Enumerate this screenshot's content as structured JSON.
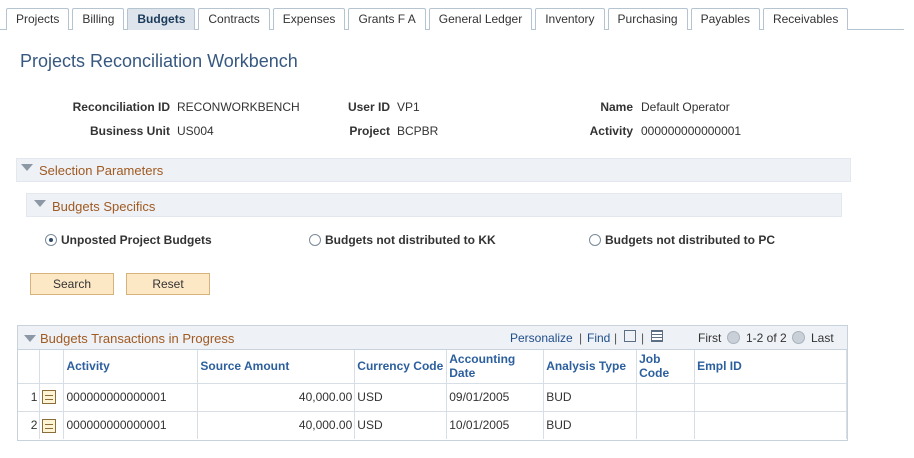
{
  "tabs": [
    {
      "label": "Projects",
      "active": false
    },
    {
      "label": "Billing",
      "active": false
    },
    {
      "label": "Budgets",
      "active": true
    },
    {
      "label": "Contracts",
      "active": false
    },
    {
      "label": "Expenses",
      "active": false
    },
    {
      "label": "Grants F A",
      "active": false
    },
    {
      "label": "General Ledger",
      "active": false
    },
    {
      "label": "Inventory",
      "active": false
    },
    {
      "label": "Purchasing",
      "active": false
    },
    {
      "label": "Payables",
      "active": false
    },
    {
      "label": "Receivables",
      "active": false
    }
  ],
  "page": {
    "title": "Projects Reconciliation Workbench"
  },
  "header": {
    "recon_id_label": "Reconciliation ID",
    "recon_id_value": "RECONWORKBENCH",
    "user_id_label": "User ID",
    "user_id_value": "VP1",
    "name_label": "Name",
    "name_value": "Default Operator",
    "bu_label": "Business Unit",
    "bu_value": "US004",
    "project_label": "Project",
    "project_value": "BCPBR",
    "activity_label": "Activity",
    "activity_value": "000000000000001"
  },
  "selection": {
    "title": "Selection Parameters"
  },
  "specifics": {
    "title": "Budgets Specifics"
  },
  "radios": [
    {
      "label": "Unposted Project Budgets",
      "selected": true
    },
    {
      "label": "Budgets not distributed to KK",
      "selected": false
    },
    {
      "label": "Budgets not distributed to PC",
      "selected": false
    }
  ],
  "buttons": {
    "search": "Search",
    "reset": "Reset"
  },
  "grid": {
    "title": "Budgets Transactions in Progress",
    "personalize": "Personalize",
    "separator": "|",
    "find": "Find",
    "first": "First",
    "range": "1-2 of 2",
    "last": "Last",
    "columns": [
      "Activity",
      "Source Amount",
      "Currency Code",
      "Accounting Date",
      "Analysis Type",
      "Job Code",
      "Empl ID"
    ],
    "rows": [
      {
        "num": "1",
        "activity": "000000000000001",
        "amount": "40,000.00",
        "currency": "USD",
        "date": "09/01/2005",
        "analysis": "BUD",
        "job": "",
        "empl": ""
      },
      {
        "num": "2",
        "activity": "000000000000001",
        "amount": "40,000.00",
        "currency": "USD",
        "date": "10/01/2005",
        "analysis": "BUD",
        "job": "",
        "empl": ""
      }
    ]
  },
  "colors": {
    "accent": "#375880",
    "section_text": "#a05a22",
    "button_bg": "#fde8c6",
    "link": "#1f4e8c"
  }
}
